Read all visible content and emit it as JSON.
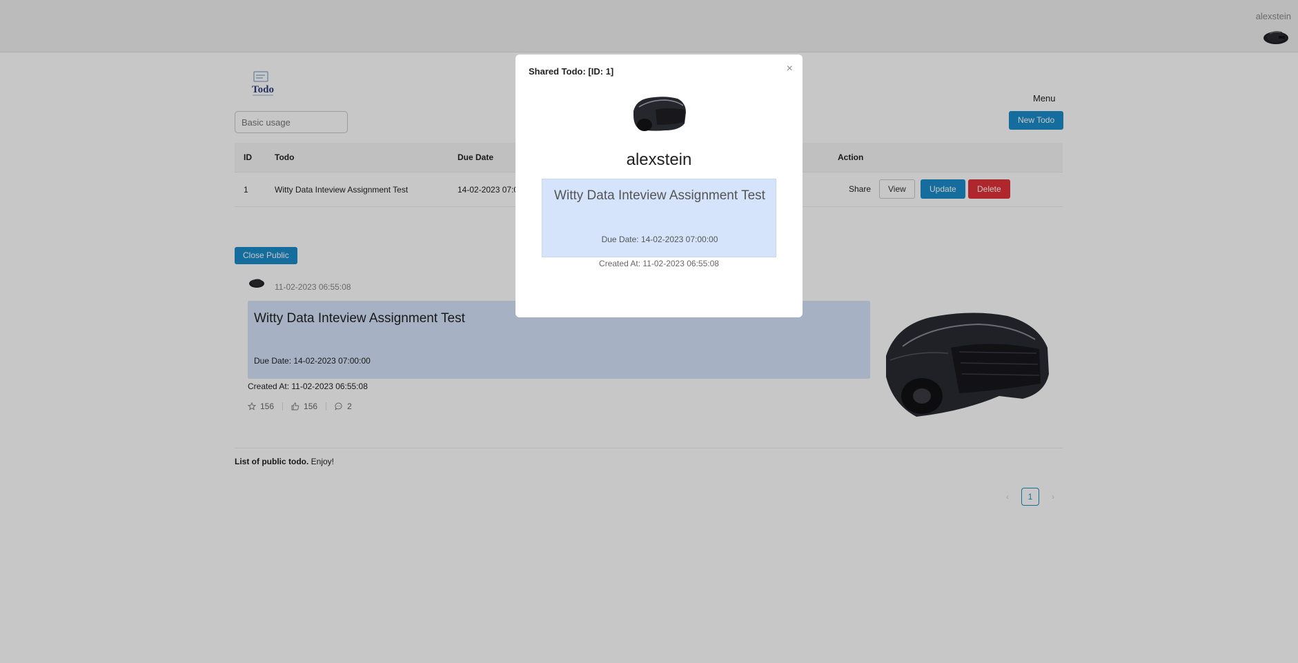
{
  "header": {
    "username": "alexstein"
  },
  "toolbar": {
    "menu_label": "Menu",
    "new_todo_label": "New Todo",
    "search_placeholder": "Basic usage"
  },
  "table": {
    "columns": {
      "id": "ID",
      "todo": "Todo",
      "due_date": "Due Date",
      "action": "Action"
    },
    "rows": [
      {
        "id": "1",
        "todo": "Witty Data Inteview Assignment Test",
        "due_date": "14-02-2023 07:0",
        "actions": {
          "share": "Share",
          "view": "View",
          "update": "Update",
          "delete": "Delete"
        }
      }
    ]
  },
  "public": {
    "close_label": "Close Public",
    "post": {
      "time": "11-02-2023 06:55:08",
      "title": "Witty Data Inteview Assignment Test",
      "due": "Due Date: 14-02-2023 07:00:00",
      "created": "Created At: 11-02-2023 06:55:08",
      "stars": "156",
      "likes": "156",
      "comments": "2"
    },
    "footer_bold": "List of public todo.",
    "footer_rest": " Enjoy!",
    "pagination": {
      "current_page": "1",
      "prev_icon": "chevron-left-icon",
      "next_icon": "chevron-right-icon"
    }
  },
  "modal": {
    "title": "Shared Todo: [ID: 1]",
    "close_icon": "×",
    "username": "alexstein",
    "todo_title": "Witty Data Inteview Assignment Test",
    "due": "Due Date: 14-02-2023 07:00:00",
    "created": "Created At: 11-02-2023 06:55:08"
  },
  "colors": {
    "primary": "#1c8cc9",
    "danger": "#e0333a",
    "card_background": "#d5e4fb",
    "overlay": "rgba(0,0,0,0.22)"
  }
}
